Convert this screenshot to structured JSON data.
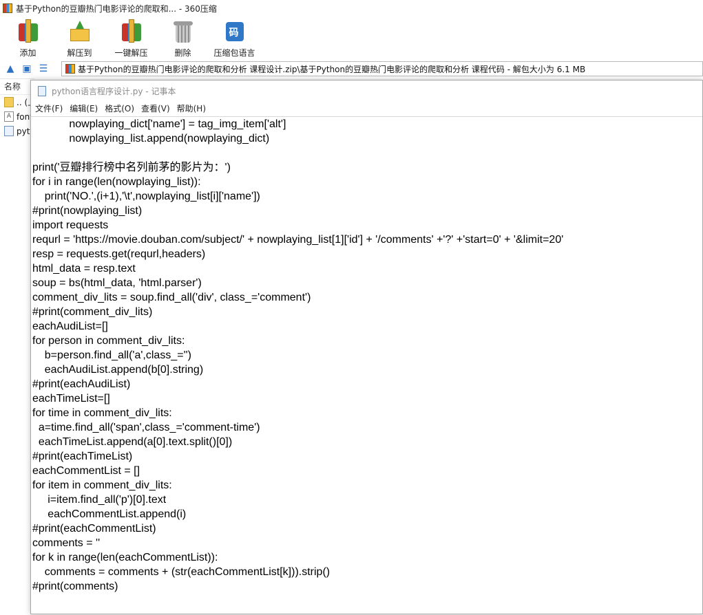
{
  "zip_window": {
    "title": "基于Python的豆瓣热门电影评论的爬取和...  - 360压缩",
    "toolbar": [
      {
        "label": "添加",
        "icon": "add-archive-icon"
      },
      {
        "label": "解压到",
        "icon": "extract-to-icon"
      },
      {
        "label": "一键解压",
        "icon": "one-click-extract-icon"
      },
      {
        "label": "删除",
        "icon": "delete-icon"
      },
      {
        "label": "压缩包语言",
        "icon": "archive-language-icon"
      }
    ],
    "address": "基于Python的豆瓣热门电影评论的爬取和分析 课程设计.zip\\基于Python的豆瓣热门电影评论的爬取和分析 课程代码 - 解包大小为 6.1 MB",
    "file_list": {
      "column_header": "名称",
      "items": [
        {
          "name": ".. (上",
          "icon": "folder-icon"
        },
        {
          "name": "font",
          "icon": "font-file-icon"
        },
        {
          "name": "pyth",
          "icon": "python-file-icon"
        }
      ]
    }
  },
  "notepad": {
    "title": "python语言程序设计.py - 记事本",
    "menu": [
      "文件(F)",
      "编辑(E)",
      "格式(O)",
      "查看(V)",
      "帮助(H)"
    ],
    "code": "            nowplaying_dict['name'] = tag_img_item['alt']\n            nowplaying_list.append(nowplaying_dict)\n\nprint('豆瓣排行榜中名列前茅的影片为：')\nfor i in range(len(nowplaying_list)):\n    print('NO.',(i+1),'\\t',nowplaying_list[i]['name'])\n#print(nowplaying_list)\nimport requests\nrequrl = 'https://movie.douban.com/subject/' + nowplaying_list[1]['id'] + '/comments' +'?' +'start=0' + '&limit=20'\nresp = requests.get(requrl,headers)\nhtml_data = resp.text\nsoup = bs(html_data, 'html.parser')\ncomment_div_lits = soup.find_all('div', class_='comment')\n#print(comment_div_lits)\neachAudiList=[]\nfor person in comment_div_lits:\n    b=person.find_all('a',class_='')\n    eachAudiList.append(b[0].string)\n#print(eachAudiList)\neachTimeList=[]\nfor time in comment_div_lits:\n  a=time.find_all('span',class_='comment-time')\n  eachTimeList.append(a[0].text.split()[0])\n#print(eachTimeList)\neachCommentList = []\nfor item in comment_div_lits:\n     i=item.find_all('p')[0].text\n     eachCommentList.append(i)\n#print(eachCommentList)\ncomments = ''\nfor k in range(len(eachCommentList)):\n    comments = comments + (str(eachCommentList[k])).strip()\n#print(comments)"
  }
}
